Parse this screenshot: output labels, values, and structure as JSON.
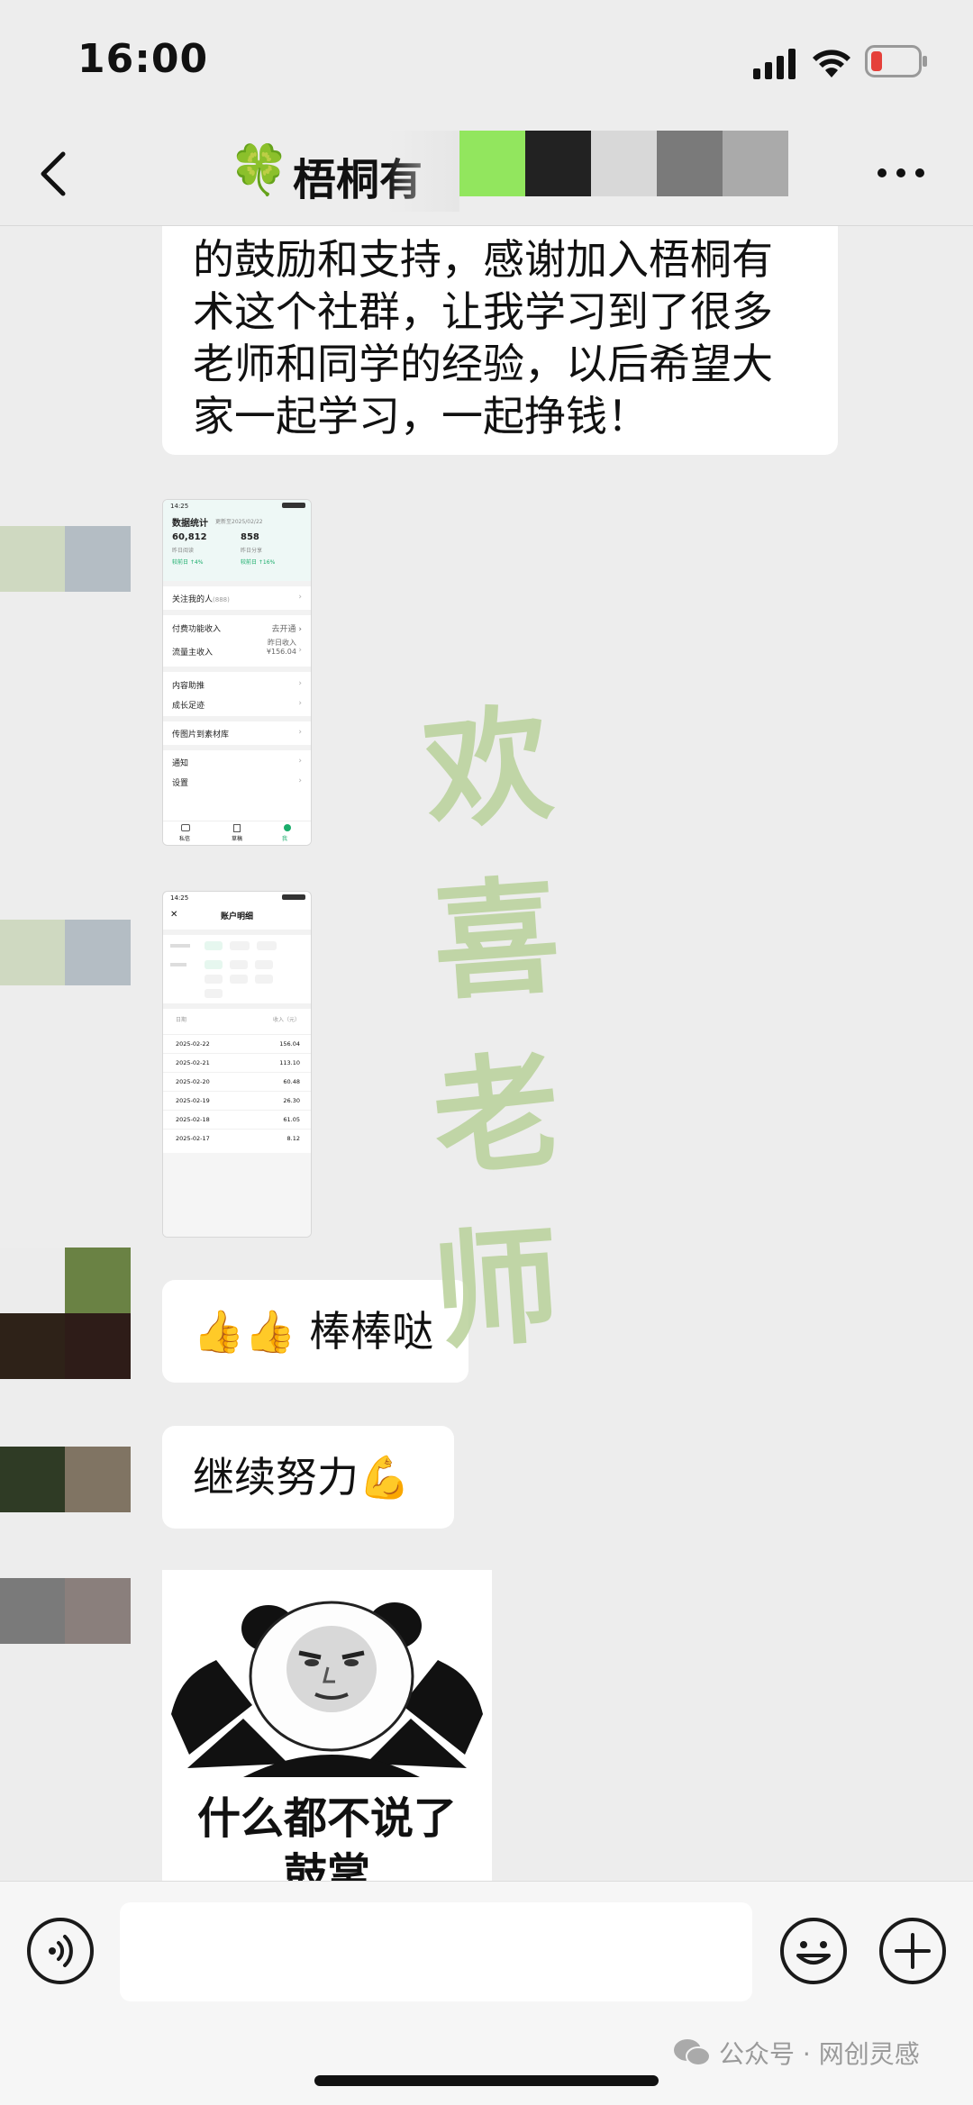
{
  "status_bar": {
    "time": "16:00",
    "battery_color": "#e5403a"
  },
  "nav": {
    "title": "梧桐有",
    "title_emoji": "🍀",
    "back_icon": "chevron-left-icon",
    "more_icon": "ellipsis-icon"
  },
  "messages": {
    "first_text": "的鼓励和支持，感谢加入梧桐有术这个社群，让我学习到了很多老师和同学的经验，以后希望大家一起学习，一起挣钱！",
    "shot1": {
      "header": "数据统计",
      "updated": "更新至2025/02/22",
      "stat1_value": "60,812",
      "stat1_label": "昨日阅读",
      "stat1_change": "较前日 ↑4%",
      "stat2_value": "858",
      "stat2_label": "昨日分享",
      "stat2_change": "较前日 ↑16%",
      "row_follow": "关注我的人",
      "row_follow_count": "(888)",
      "row_paid": "付费功能收入",
      "row_paid_right": "去开通",
      "row_traffic": "流量主收入",
      "row_traffic_right1": "昨日收入",
      "row_traffic_right2": "¥156.04",
      "row_content": "内容助推",
      "row_growth": "成长足迹",
      "row_upload": "传图片到素材库",
      "row_notice": "通知",
      "row_settings": "设置",
      "tab1": "私信",
      "tab2": "草稿",
      "tab3": "我",
      "time": "14:25"
    },
    "shot2": {
      "time": "14:25",
      "title": "账户明细",
      "col_date": "日期",
      "col_income": "收入（元）",
      "rows": [
        {
          "date": "2025-02-22",
          "amount": "156.04"
        },
        {
          "date": "2025-02-21",
          "amount": "113.10"
        },
        {
          "date": "2025-02-20",
          "amount": "60.48"
        },
        {
          "date": "2025-02-19",
          "amount": "26.30"
        },
        {
          "date": "2025-02-18",
          "amount": "61.05"
        },
        {
          "date": "2025-02-17",
          "amount": "8.12"
        }
      ]
    },
    "thumbs_text": "👍👍 棒棒哒",
    "keepup_text": "继续努力💪",
    "meme_caption_line1": "什么都不说了",
    "meme_caption_line2": "鼓掌"
  },
  "watermark": [
    "欢",
    "喜",
    "老",
    "师"
  ],
  "watermark_color": "#b9d19a",
  "input_bar": {
    "voice_icon": "voice-icon",
    "emoji_icon": "smiley-icon",
    "plus_icon": "plus-icon"
  },
  "footer_credit": "公众号 · 网创灵感"
}
